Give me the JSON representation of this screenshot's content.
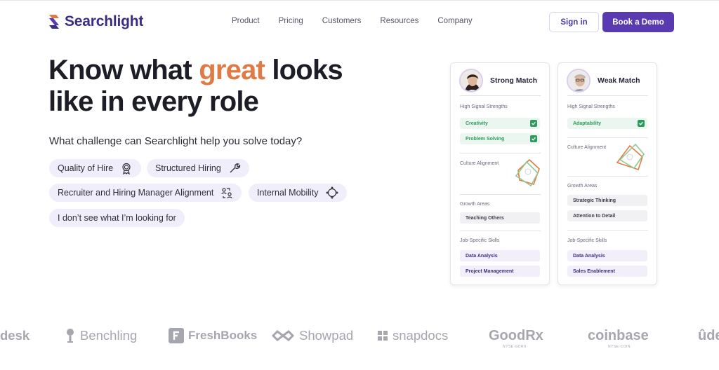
{
  "header": {
    "brand": "Searchlight",
    "nav": [
      "Product",
      "Pricing",
      "Customers",
      "Resources",
      "Company"
    ],
    "sign_in": "Sign in",
    "book_demo": "Book a Demo"
  },
  "hero": {
    "headline_pre": "Know what ",
    "headline_accent": "great",
    "headline_post": " looks",
    "headline_line2": "like in every role",
    "question": "What challenge can Searchlight help you solve today?",
    "chips": [
      {
        "label": "Quality of Hire",
        "icon": "award-ribbon-icon"
      },
      {
        "label": "Structured Hiring",
        "icon": "wrench-icon"
      },
      {
        "label": "Recruiter and Hiring Manager Alignment",
        "icon": "people-connect-icon"
      },
      {
        "label": "Internal Mobility",
        "icon": "move-arrows-icon"
      },
      {
        "label": "I don’t see what I’m looking for",
        "icon": null
      }
    ],
    "accent_color": "#e07b45",
    "brand_color": "#5a3ab0"
  },
  "cards": {
    "strong": {
      "title": "Strong Match",
      "strengths_label": "High Signal Strengths",
      "strengths": [
        "Creativity",
        "Problem Solving"
      ],
      "culture_label": "Culture Alignment",
      "growth_label": "Growth Areas",
      "growth": [
        "Teaching Others"
      ],
      "skills_label": "Job-Specific Skills",
      "skills": [
        "Data Analysis",
        "Project Management"
      ]
    },
    "weak": {
      "title": "Weak Match",
      "strengths_label": "High Signal Strengths",
      "strengths": [
        "Adaptability"
      ],
      "culture_label": "Culture Alignment",
      "growth_label": "Growth Areas",
      "growth": [
        "Strategic Thinking",
        "Attention to Detail"
      ],
      "skills_label": "Job-Specific Skills",
      "skills": [
        "Data Analysis",
        "Sales Enablement"
      ]
    }
  },
  "logos": {
    "items": [
      "desk",
      "Benchling",
      "FreshBooks",
      "Showpad",
      "snapdocs",
      "GoodRx",
      "coinbase",
      "ûde"
    ],
    "goodrx_sub": "NYSE:GDRX",
    "coinbase_sub": "NYSE:COIN"
  }
}
